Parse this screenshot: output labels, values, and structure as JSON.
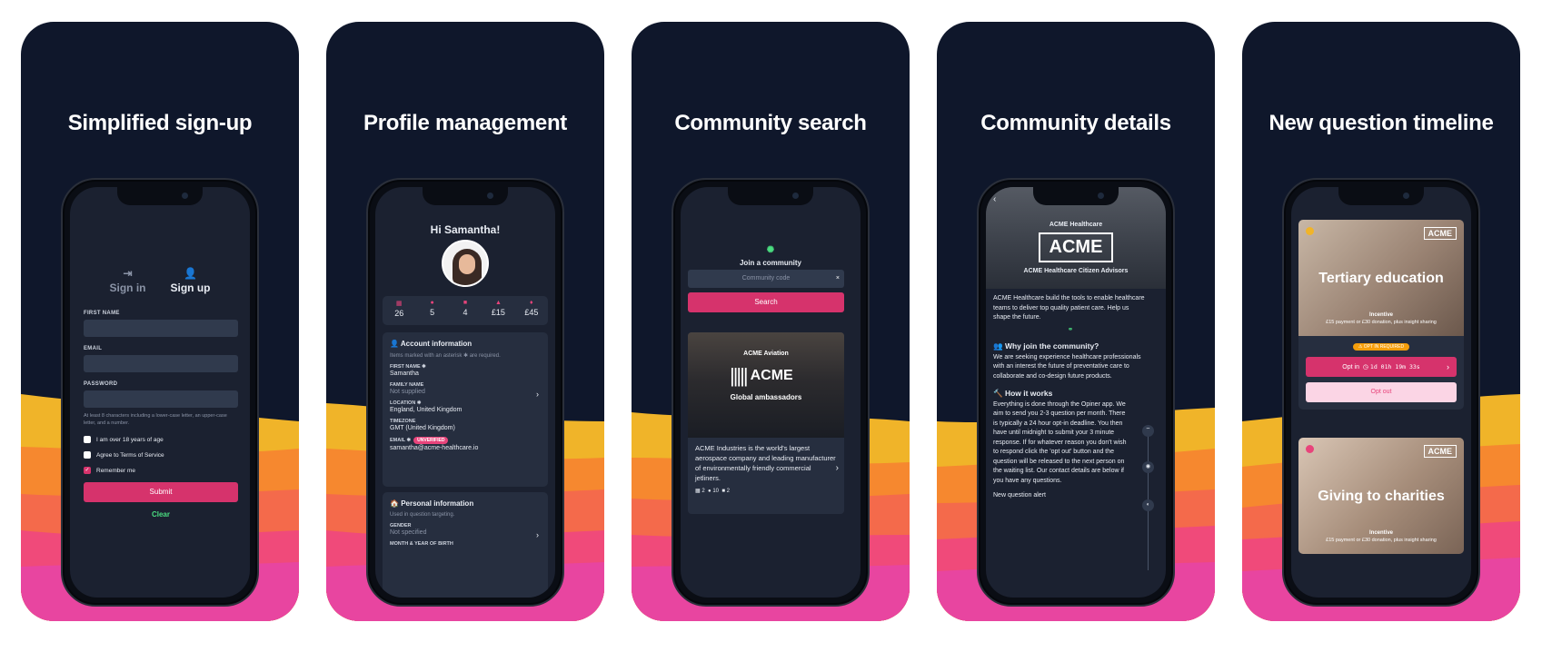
{
  "panels": [
    {
      "title": "Simplified sign-up"
    },
    {
      "title": "Profile management"
    },
    {
      "title": "Community search"
    },
    {
      "title": "Community details"
    },
    {
      "title": "New question timeline"
    }
  ],
  "signup": {
    "tab_signin": "Sign in",
    "tab_signup": "Sign up",
    "first_name_label": "FIRST NAME",
    "email_label": "EMAIL",
    "password_label": "PASSWORD",
    "password_hint": "At least 8 characters including a lower-case letter, an upper-case letter, and a number.",
    "check_age": "I am over 18 years of age",
    "check_terms": "Agree to Terms of Service",
    "check_remember": "Remember me",
    "remember_checked": true,
    "submit": "Submit",
    "clear": "Clear"
  },
  "profile": {
    "greeting": "Hi Samantha!",
    "stats": [
      "26",
      "5",
      "4",
      "£15",
      "£45"
    ],
    "account_heading": "Account information",
    "asterisk_note": "Items marked with an asterisk ✱ are required.",
    "first_name_label": "FIRST NAME ✱",
    "first_name": "Samantha",
    "family_name_label": "FAMILY NAME",
    "family_name": "Not supplied",
    "location_label": "LOCATION ✱",
    "location": "England, United Kingdom",
    "timezone_label": "TIMEZONE",
    "timezone": "GMT (United Kingdom)",
    "email_label": "EMAIL ✱",
    "email_badge": "UNVERIFIED",
    "email": "samantha@acme-healthcare.io",
    "personal_heading": "Personal information",
    "targeting_note": "Used in question targeting.",
    "gender_label": "GENDER",
    "gender": "Not specified",
    "birth_label": "MONTH & YEAR OF BIRTH"
  },
  "search": {
    "join": "Join a community",
    "placeholder": "Community code",
    "clear": "×",
    "button": "Search",
    "card_org": "ACME Aviation",
    "card_logo": "ACME",
    "card_name": "Global ambassadors",
    "card_desc": "ACME Industries is the world's largest aerospace company and leading manufacturer of environmentally friendly commercial jetliners.",
    "card_stats": [
      "2",
      "10",
      "2"
    ]
  },
  "details": {
    "org": "ACME Healthcare",
    "logo": "ACME",
    "community": "ACME Healthcare Citizen Advisors",
    "intro": "ACME Healthcare build the tools to enable healthcare teams to deliver top quality patient care. Help us shape the future.",
    "why_heading": "Why join the community?",
    "why_text": "We are seeking experience healthcare professionals with an interest the future of preventative care to collaborate and co-design future products.",
    "how_heading": "How it works",
    "how_text": "Everything is done through the Opiner app. We aim to send you 2-3 question per month. There is typically a 24 hour opt-in deadline. You then have until midnight to submit your 3 minute response. If for whatever reason you don't wish to respond click the 'opt out' button and the question will be released to the next person on the waiting list. Our contact details are below if you have any questions.",
    "next": "New question alert"
  },
  "timeline": {
    "q1_title": "Tertiary education",
    "q1_logo": "ACME",
    "incentive_label": "Incentive",
    "incentive_text": "£15 payment or £30 donation, plus insight sharing",
    "opt_required": "OPT IN REQUIRED",
    "optin_label": "Opt in",
    "optin_timer": "1d 01h 19m 33s",
    "optout_label": "Opt out",
    "q2_title": "Giving to charities",
    "q2_logo": "ACME",
    "q2_incentive_label": "Incentive",
    "q2_incentive_text": "£15 payment or £30 donation, plus insight sharing"
  },
  "colors": {
    "background": "#0f172b",
    "accent": "#d6336c",
    "success": "#4ade80",
    "warning": "#f59e0b"
  }
}
